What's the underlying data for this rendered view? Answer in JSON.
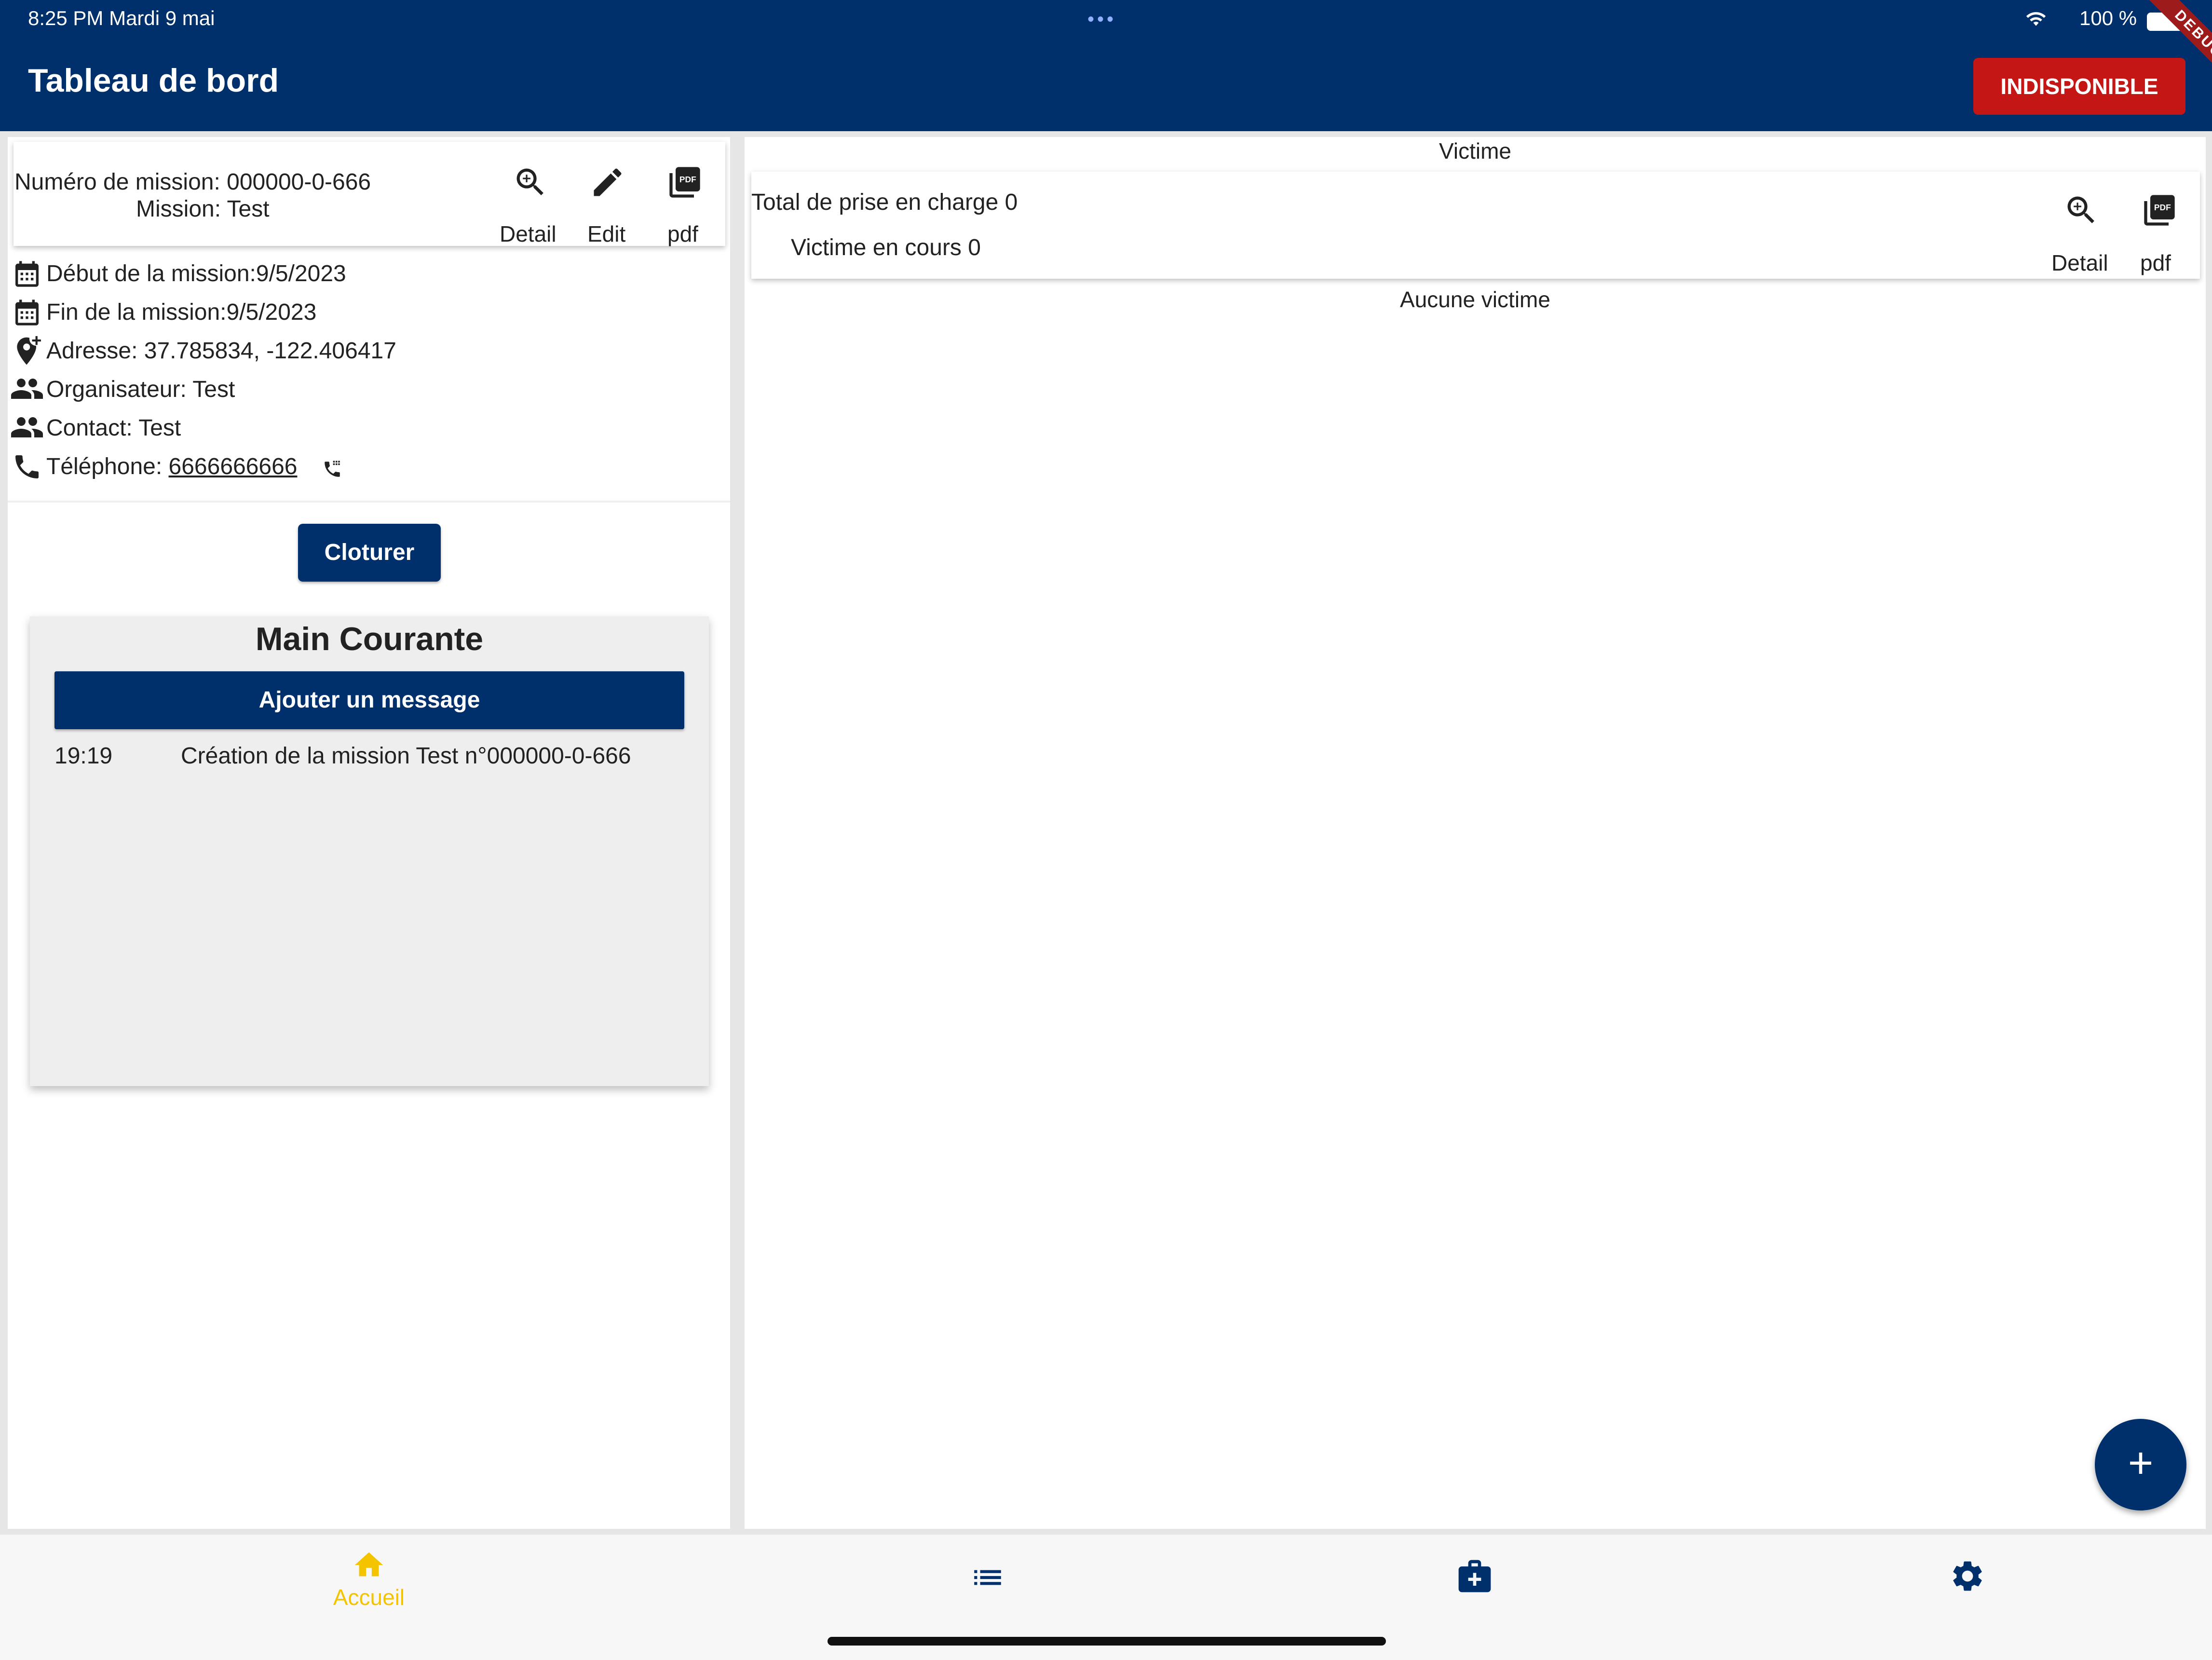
{
  "status_bar": {
    "time_date": "8:25 PM   Mardi 9 mai",
    "dots": "•••",
    "battery": "100 %",
    "debug": "DEBUG"
  },
  "header": {
    "title": "Tableau de bord",
    "status_button": "INDISPONIBLE"
  },
  "mission": {
    "number": "Numéro de mission: 000000-0-666",
    "name": "Mission: Test",
    "actions": [
      {
        "label": "Detail",
        "icon": "zoom-in-icon"
      },
      {
        "label": "Edit",
        "icon": "edit-icon"
      },
      {
        "label": "pdf",
        "icon": "pdf-icon"
      }
    ],
    "info": {
      "debut": "Début de la mission:9/5/2023",
      "fin": "Fin de la mission:9/5/2023",
      "adresse": "Adresse: 37.785834, -122.406417",
      "organisateur": "Organisateur: Test",
      "contact": "Contact: Test",
      "telephone_label": "Téléphone: ",
      "telephone_value": "6666666666"
    },
    "close_button": "Cloturer"
  },
  "main_courante": {
    "title": "Main Courante",
    "add_button": "Ajouter un message",
    "entries": [
      {
        "time": "19:19",
        "message": "Création de la mission Test n°000000-0-666"
      }
    ]
  },
  "victime": {
    "title": "Victime",
    "total": "Total de prise en charge 0",
    "en_cours": "Victime en cours 0",
    "actions": [
      {
        "label": "Detail",
        "icon": "zoom-in-icon"
      },
      {
        "label": "pdf",
        "icon": "pdf-icon"
      }
    ],
    "empty": "Aucune victime",
    "fab": "+"
  },
  "bottom_nav": {
    "items": [
      {
        "label": "Accueil",
        "icon": "home-icon",
        "active": true
      },
      {
        "label": "",
        "icon": "list-icon"
      },
      {
        "label": "",
        "icon": "medical-kit-icon"
      },
      {
        "label": "",
        "icon": "settings-icon"
      }
    ]
  },
  "colors": {
    "primary": "#00306b",
    "danger": "#c51616",
    "active_nav": "#f5c400"
  }
}
